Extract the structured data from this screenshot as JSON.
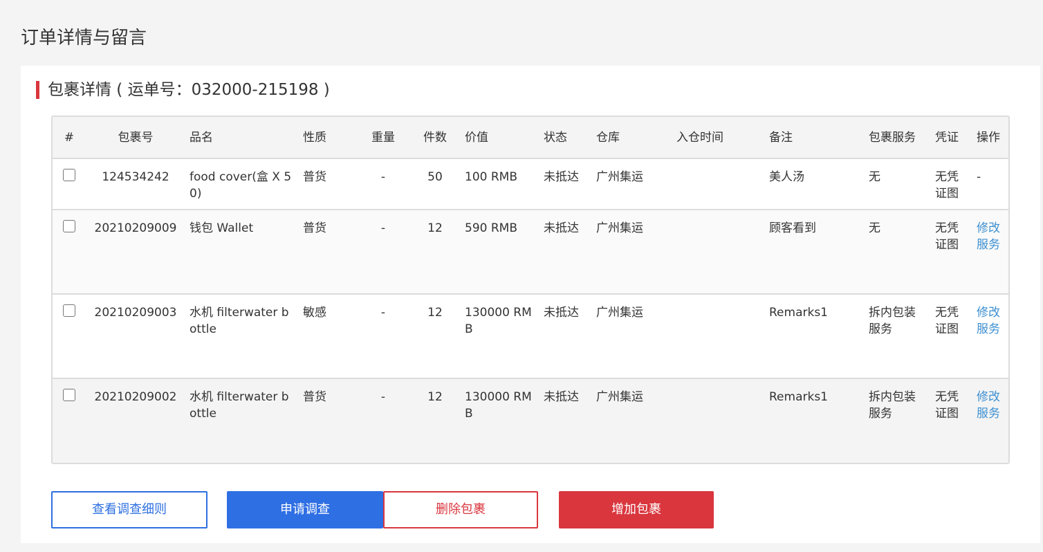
{
  "page_title": "订单详情与留言",
  "section_title": "包裹详情 ( 运单号：032000-215198 )",
  "columns": [
    "#",
    "包裹号",
    "品名",
    "性质",
    "重量",
    "件数",
    "价值",
    "状态",
    "仓库",
    "入仓时间",
    "备注",
    "包裹服务",
    "凭证",
    "操作"
  ],
  "rows": [
    {
      "package_no": "124534242",
      "name": "food cover(盒 X 50)",
      "nature": "普货",
      "weight": "-",
      "count": "50",
      "value": "100 RMB",
      "status": "未抵达",
      "warehouse": "广州集运",
      "in_time": "",
      "remark": "美人汤",
      "service": "无",
      "voucher": "无凭证图",
      "action": "-"
    },
    {
      "package_no": "20210209009",
      "name": "钱包 Wallet",
      "nature": "普货",
      "weight": "-",
      "count": "12",
      "value": "590 RMB",
      "status": "未抵达",
      "warehouse": "广州集运",
      "in_time": "",
      "remark": "顾客看到",
      "service": "无",
      "voucher": "无凭证图",
      "action": "修改服务"
    },
    {
      "package_no": "20210209003",
      "name": "水机 filterwater bottle",
      "nature": "敏感",
      "weight": "-",
      "count": "12",
      "value": "130000 RMB",
      "status": "未抵达",
      "warehouse": "广州集运",
      "in_time": "",
      "remark": "Remarks1",
      "service": "拆内包装服务",
      "voucher": "无凭证图",
      "action": "修改服务"
    },
    {
      "package_no": "20210209002",
      "name": "水机 filterwater bottle",
      "nature": "普货",
      "weight": "-",
      "count": "12",
      "value": "130000 RMB",
      "status": "未抵达",
      "warehouse": "广州集运",
      "in_time": "",
      "remark": "Remarks1",
      "service": "拆内包装服务",
      "voucher": "无凭证图",
      "action": "修改服务"
    }
  ],
  "buttons": {
    "view_rules": "查看调查细则",
    "apply_investigation": "申请调查",
    "delete_package": "删除包裹",
    "add_package": "增加包裹"
  },
  "colors": {
    "accent_red": "#d9363e",
    "primary_blue": "#2f6fe4",
    "link_blue": "#3d8fd1"
  }
}
